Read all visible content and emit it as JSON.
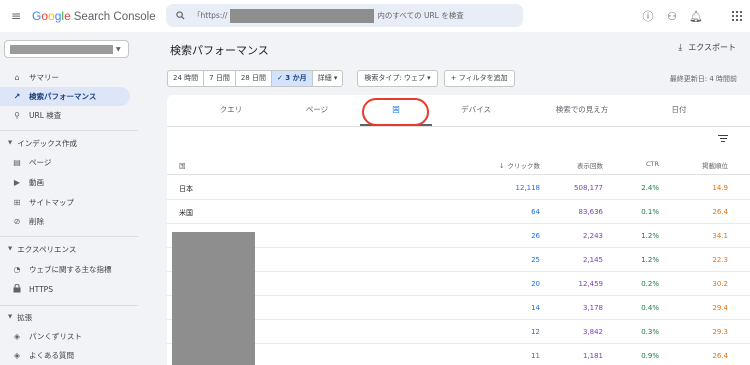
{
  "topbar": {
    "menu_icon": "≡",
    "logo": [
      "G",
      "o",
      "o",
      "g",
      "l",
      "e"
    ],
    "product": "Search Console",
    "search_prefix": "「https://",
    "search_suffix": "内のすべての URL を検査",
    "icons": [
      "help-icon",
      "account-settings-icon",
      "notifications-icon",
      "apps-icon"
    ]
  },
  "sidebar": {
    "items": [
      {
        "icon": "home-icon",
        "glyph": "⌂",
        "label": "サマリー"
      },
      {
        "icon": "trending-icon",
        "glyph": "↗",
        "label": "検索パフォーマンス"
      },
      {
        "icon": "search-icon",
        "glyph": "⚲",
        "label": "URL 検査"
      }
    ],
    "sections": {
      "index": "インデックス作成",
      "experience": "エクスペリエンス",
      "enhancements": "拡張"
    },
    "index_items": [
      {
        "icon": "page-icon",
        "glyph": "▤",
        "label": "ページ"
      },
      {
        "icon": "video-icon",
        "glyph": "▶",
        "label": "動画"
      },
      {
        "icon": "sitemap-icon",
        "glyph": "⊞",
        "label": "サイトマップ"
      },
      {
        "icon": "remove-icon",
        "glyph": "⊘",
        "label": "削除"
      }
    ],
    "experience_items": [
      {
        "icon": "speed-icon",
        "glyph": "◔",
        "label": "ウェブに関する主な指標"
      },
      {
        "icon": "lock-icon",
        "glyph": "🔒",
        "label": "HTTPS"
      }
    ],
    "enhancement_items": [
      {
        "icon": "breadcrumb-icon",
        "glyph": "◈",
        "label": "パンくずリスト"
      },
      {
        "icon": "faq-icon",
        "glyph": "◈",
        "label": "よくある質問"
      }
    ]
  },
  "main": {
    "title": "検索パフォーマンス",
    "export_label": "エクスポート",
    "date_ranges": [
      "24 時間",
      "7 日間",
      "28 日間",
      "✓ 3 か月",
      "詳細 ▾"
    ],
    "selected_range_index": 3,
    "search_type": "検索タイプ: ウェブ ▾",
    "add_filter": "+ フィルタを追加",
    "last_updated": "最終更新日: 4 時間前"
  },
  "tabs": [
    "クエリ",
    "ページ",
    "国",
    "デバイス",
    "検索での見え方",
    "日付"
  ],
  "active_tab_index": 2,
  "table": {
    "headers": {
      "country": "国",
      "clicks": "クリック数",
      "impressions": "表示回数",
      "ctr": "CTR",
      "position": "掲載順位"
    },
    "rows": [
      {
        "country": "日本",
        "clicks": "12,118",
        "impressions": "508,177",
        "ctr": "2.4%",
        "position": "14.9"
      },
      {
        "country": "米国",
        "clicks": "64",
        "impressions": "83,636",
        "ctr": "0.1%",
        "position": "26.4"
      },
      {
        "country": "",
        "clicks": "26",
        "impressions": "2,243",
        "ctr": "1.2%",
        "position": "34.1"
      },
      {
        "country": "",
        "clicks": "25",
        "impressions": "2,145",
        "ctr": "1.2%",
        "position": "22.3"
      },
      {
        "country": "",
        "clicks": "20",
        "impressions": "12,459",
        "ctr": "0.2%",
        "position": "30.2"
      },
      {
        "country": "",
        "clicks": "14",
        "impressions": "3,178",
        "ctr": "0.4%",
        "position": "29.4"
      },
      {
        "country": "",
        "clicks": "12",
        "impressions": "3,842",
        "ctr": "0.3%",
        "position": "29.3"
      },
      {
        "country": "",
        "clicks": "11",
        "impressions": "1,181",
        "ctr": "0.9%",
        "position": "26.4"
      }
    ]
  },
  "colors": {
    "clicks": "#1a73e8",
    "impressions": "#7e3ac6",
    "ctr": "#188038",
    "position": "#e8710a",
    "highlight_oval": "#e53b2c"
  }
}
